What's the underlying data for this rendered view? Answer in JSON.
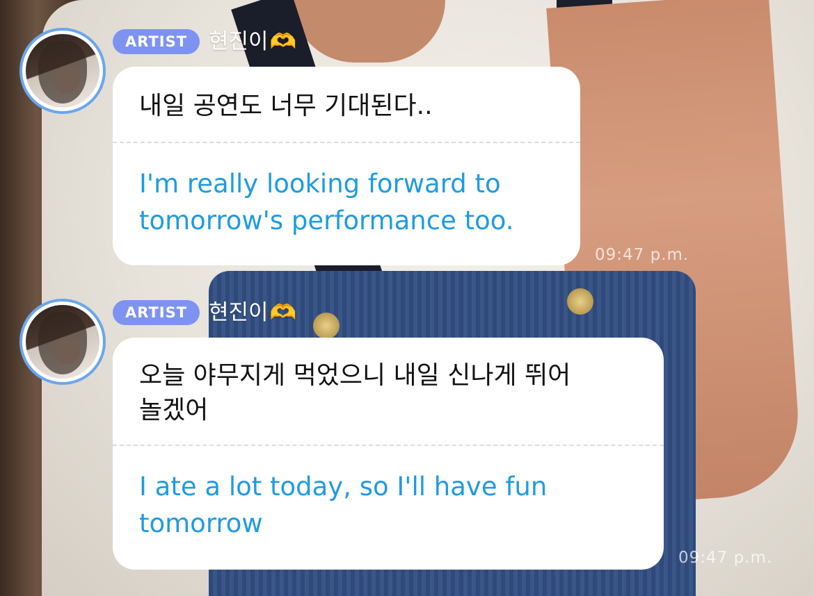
{
  "messages": [
    {
      "badge": "ARTIST",
      "sender": "현진이",
      "sender_emoji": "🫶",
      "original": "내일 공연도 너무 기대된다..",
      "translation": "I'm really looking forward to\ntomorrow's performance too.",
      "time": "09:47 p.m."
    },
    {
      "badge": "ARTIST",
      "sender": "현진이",
      "sender_emoji": "🫶",
      "original": "오늘 야무지게 먹었으니 내일 신나게 뛰어\n놀겠어",
      "translation": "I ate a lot today, so I'll have fun\ntomorrow",
      "time": "09:47 p.m."
    }
  ]
}
